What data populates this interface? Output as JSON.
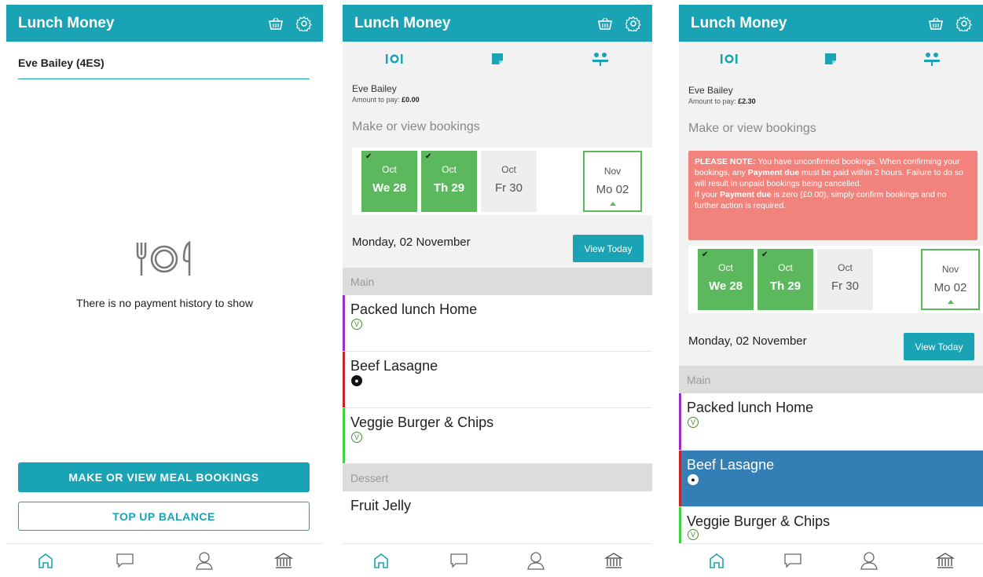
{
  "colors": {
    "brand": "#1aa3b5",
    "booked": "#5cb85c",
    "notice": "#f2837c",
    "selected_meal": "#337fb5",
    "accent_purple": "#9b2fbf",
    "accent_red": "#c0262c",
    "accent_green": "#3fd23f"
  },
  "app": {
    "title": "Lunch Money"
  },
  "screen1": {
    "child_name": "Eve Bailey (4ES)",
    "empty_message": "There is no payment history to show",
    "primary_button": "MAKE OR VIEW MEAL BOOKINGS",
    "secondary_button": "TOP UP BALANCE"
  },
  "screen2": {
    "child": "Eve Bailey",
    "amount_label": "Amount to pay:",
    "amount_value": "£0.00",
    "heading": "Make or view bookings",
    "days": [
      {
        "month": "Oct",
        "day": "We 28",
        "state": "booked"
      },
      {
        "month": "Oct",
        "day": "Th 29",
        "state": "booked"
      },
      {
        "month": "Oct",
        "day": "Fr 30",
        "state": "empty"
      },
      {
        "month": "Nov",
        "day": "Mo 02",
        "state": "selected"
      }
    ],
    "date_heading": "Monday, 02 November",
    "view_today": "View Today",
    "section_main": "Main",
    "meals": [
      {
        "name": "Packed lunch Home",
        "icon": "vegetarian-icon"
      },
      {
        "name": "Beef Lasagne",
        "icon": "beef-icon"
      },
      {
        "name": "Veggie Burger & Chips",
        "icon": "vegetarian-icon"
      }
    ],
    "section_dessert": "Dessert",
    "dessert": "Fruit Jelly"
  },
  "screen3": {
    "child": "Eve Bailey",
    "amount_label": "Amount to pay:",
    "amount_value": "£2.30",
    "heading": "Make or view bookings",
    "notice": {
      "label": "PLEASE NOTE:",
      "part1": " You have unconfirmed bookings. When confirming your bookings, any ",
      "bold1": "Payment due",
      "part2": " must be paid within 2 hours. Failure to do so will result in unpaid bookings being cancelled.",
      "part3": "If your ",
      "bold2": "Payment due",
      "part4": " is zero (£0.00), simply confirm bookings and no further action is required."
    },
    "days": [
      {
        "month": "Oct",
        "day": "We 28",
        "state": "booked"
      },
      {
        "month": "Oct",
        "day": "Th 29",
        "state": "booked"
      },
      {
        "month": "Oct",
        "day": "Fr 30",
        "state": "empty"
      },
      {
        "month": "Nov",
        "day": "Mo 02",
        "state": "selected"
      }
    ],
    "date_heading": "Monday, 02 November",
    "view_today": "View Today",
    "section_main": "Main",
    "meals": [
      {
        "name": "Packed lunch Home",
        "icon": "vegetarian-icon"
      },
      {
        "name": "Beef Lasagne",
        "icon": "beef-icon",
        "selected": true
      },
      {
        "name": "Veggie Burger & Chips",
        "icon": "vegetarian-icon"
      }
    ]
  },
  "icons": {
    "basket": "basket-icon",
    "settings": "gear-icon",
    "meals_tab": "plate-cutlery-icon",
    "notes_tab": "note-icon",
    "people_tab": "people-icon",
    "home": "home-icon",
    "messages": "chat-icon",
    "profile": "user-icon",
    "bank": "bank-icon"
  }
}
